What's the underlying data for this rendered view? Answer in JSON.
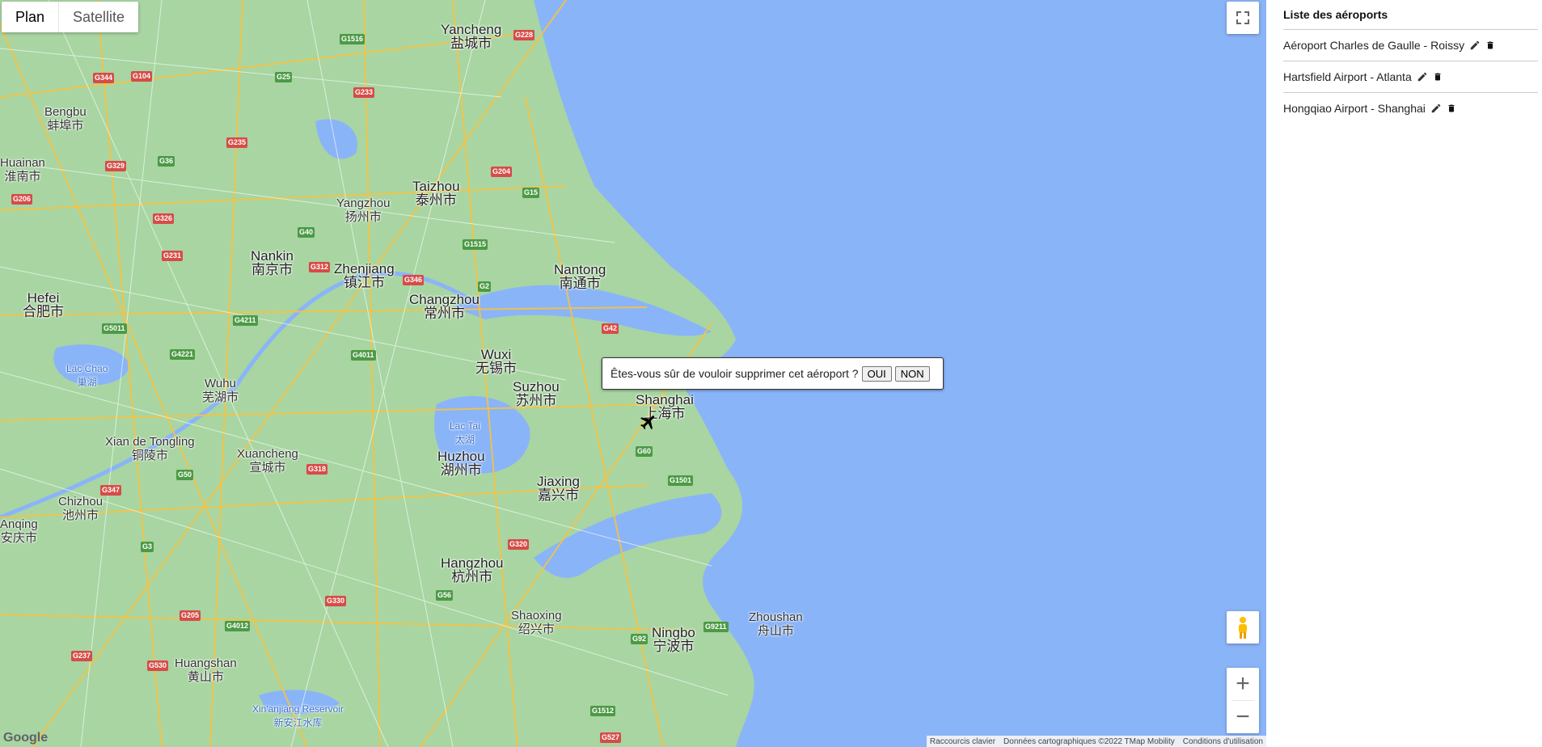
{
  "map": {
    "map_type_plan": "Plan",
    "map_type_satellite": "Satellite",
    "colors": {
      "water": "#8ab4f8",
      "land": "#a8d5a2",
      "road": "#f6c342",
      "highway_red": "#d64c47",
      "highway_green": "#4c9a45"
    },
    "labels": [
      {
        "name": "Yancheng",
        "cn": "盐城市"
      },
      {
        "name": "Bengbu",
        "cn": "蚌埠市"
      },
      {
        "name": "Taizhou",
        "cn": "泰州市"
      },
      {
        "name": "Yangzhou",
        "cn": "扬州市"
      },
      {
        "name": "Nankin",
        "cn": "南京市"
      },
      {
        "name": "Zhenjiang",
        "cn": "镇江市"
      },
      {
        "name": "Nantong",
        "cn": "南通市"
      },
      {
        "name": "Hefei",
        "cn": "合肥市"
      },
      {
        "name": "Changzhou",
        "cn": "常州市"
      },
      {
        "name": "Wuxi",
        "cn": "无锡市"
      },
      {
        "name": "Suzhou",
        "cn": "苏州市"
      },
      {
        "name": "Shanghai",
        "cn": "上海市"
      },
      {
        "name": "Wuhu",
        "cn": "芜湖市"
      },
      {
        "name": "Xian de Tongling",
        "cn": "铜陵市"
      },
      {
        "name": "Xuancheng",
        "cn": "宣城市"
      },
      {
        "name": "Huzhou",
        "cn": "湖州市"
      },
      {
        "name": "Jiaxing",
        "cn": "嘉兴市"
      },
      {
        "name": "Chizhou",
        "cn": "池州市"
      },
      {
        "name": "Hangzhou",
        "cn": "杭州市"
      },
      {
        "name": "Shaoxing",
        "cn": "绍兴市"
      },
      {
        "name": "Ningbo",
        "cn": "宁波市"
      },
      {
        "name": "Zhoushan",
        "cn": "舟山市"
      },
      {
        "name": "Huangshan",
        "cn": "黄山市"
      },
      {
        "name": "Anqing",
        "cn": "安庆市"
      },
      {
        "name": "Huainan",
        "cn": "淮南市"
      }
    ],
    "water_labels": [
      {
        "name": "Lac Chao",
        "cn": "巢湖"
      },
      {
        "name": "Lac Tai",
        "cn": "太湖"
      },
      {
        "name": "Xin'anjiang Reservoir",
        "cn": "新安江水库"
      }
    ],
    "shields": [
      "G1516",
      "G228",
      "G344",
      "G104",
      "G25",
      "G233",
      "G36",
      "G235",
      "G329",
      "G40",
      "G15",
      "G312",
      "G4211",
      "G5011",
      "G4221",
      "G346",
      "G4011",
      "G42",
      "G60",
      "G1501",
      "G320",
      "G330",
      "G92",
      "G9211",
      "G1512",
      "G527",
      "G237",
      "G530",
      "G205",
      "G4012",
      "G56",
      "G50",
      "G318",
      "G3",
      "G347",
      "G206",
      "G231",
      "G326",
      "G1515",
      "G204",
      "G2"
    ],
    "attribution": {
      "shortcuts": "Raccourcis clavier",
      "data": "Données cartographiques ©2022 TMap Mobility",
      "terms": "Conditions d'utilisation"
    },
    "logo": "Google"
  },
  "dialog": {
    "question": "Êtes-vous sûr de vouloir supprimer cet aéroport ?",
    "yes": "OUI",
    "no": "NON"
  },
  "panel": {
    "title": "Liste des aéroports",
    "airports": [
      {
        "name": "Aéroport Charles de Gaulle - Roissy"
      },
      {
        "name": "Hartsfield Airport - Atlanta"
      },
      {
        "name": "Hongqiao Airport - Shanghai"
      }
    ]
  }
}
